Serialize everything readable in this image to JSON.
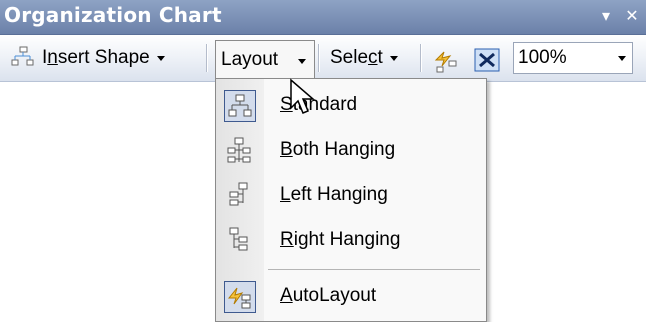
{
  "titlebar": {
    "title": "Organization Chart",
    "menu_icon": "chevron-down-icon",
    "close_icon": "close-icon"
  },
  "toolbar": {
    "insert_shape": {
      "label": "Insert Shape",
      "mnemonic": "n",
      "icon": "org-chart-icon"
    },
    "layout": {
      "label": "Layout"
    },
    "select": {
      "label": "Select",
      "mnemonic": "c"
    },
    "autolayout_icon": "autolayout-icon",
    "fit_text_icon": "fit-text-icon",
    "zoom": "100%"
  },
  "menu": {
    "items": [
      {
        "label": "Standard",
        "mnemonic_index": 0,
        "icon": "standard-layout-icon",
        "checked": true
      },
      {
        "label": "Both Hanging",
        "mnemonic_index": 0,
        "icon": "both-hanging-icon",
        "checked": false
      },
      {
        "label": "Left Hanging",
        "mnemonic_index": 0,
        "icon": "left-hanging-icon",
        "checked": false
      },
      {
        "label": "Right Hanging",
        "mnemonic_index": 0,
        "icon": "right-hanging-icon",
        "checked": false
      },
      {
        "label": "AutoLayout",
        "mnemonic_index": 0,
        "icon": "autolayout-icon",
        "checked": true
      }
    ]
  },
  "colors": {
    "titlebar": "#7a8fb5",
    "menu_bg": "#f9f9f9",
    "checked_bg": "#d3dcec",
    "checked_border": "#3f5a8f"
  }
}
